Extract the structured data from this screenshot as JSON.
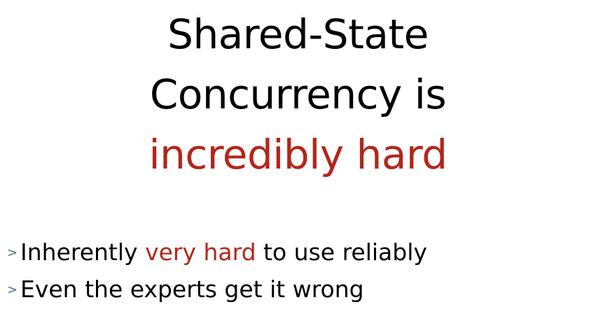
{
  "title": {
    "line1": "Shared-State",
    "line2": "Concurrency is",
    "line3": "incredibly hard"
  },
  "bullets": [
    {
      "marker": ">",
      "before": "Inherently ",
      "highlight": "very hard",
      "after": " to use reliably"
    },
    {
      "marker": ">",
      "text": "Even the experts get it wrong"
    }
  ],
  "colors": {
    "emphasis": "#b3261a",
    "bullet_marker": "#4a6d86",
    "text": "#000000",
    "background": "#ffffff"
  }
}
